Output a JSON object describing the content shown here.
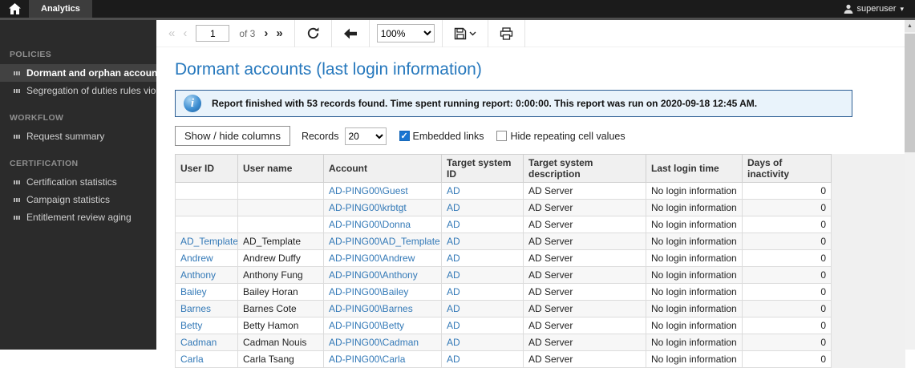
{
  "topbar": {
    "tab_label": "Analytics",
    "user_label": "superuser",
    "user_caret": "▾"
  },
  "sidebar": {
    "sections": [
      {
        "title": "POLICIES",
        "items": [
          {
            "label": "Dormant and orphan accounts",
            "active": true
          },
          {
            "label": "Segregation of duties rules viola...",
            "active": false
          }
        ]
      },
      {
        "title": "WORKFLOW",
        "items": [
          {
            "label": "Request summary",
            "active": false
          }
        ]
      },
      {
        "title": "CERTIFICATION",
        "items": [
          {
            "label": "Certification statistics",
            "active": false
          },
          {
            "label": "Campaign statistics",
            "active": false
          },
          {
            "label": "Entitlement review aging",
            "active": false
          }
        ]
      }
    ]
  },
  "toolbar": {
    "first_page_label": "«",
    "prev_page_label": "‹",
    "page_value": "1",
    "page_total_label": "of 3",
    "next_page_label": "›",
    "last_page_label": "»",
    "zoom_value": "100%"
  },
  "report": {
    "title": "Dormant accounts (last login information)",
    "info_message": "Report finished with 53 records found. Time spent running report: 0:00:00. This report was run on 2020-09-18 12:45 AM.",
    "controls": {
      "show_hide_button": "Show / hide columns",
      "records_label": "Records",
      "records_value": "20",
      "embedded_links_label": "Embedded links",
      "embedded_links_checked": true,
      "hide_repeating_label": "Hide repeating cell values",
      "hide_repeating_checked": false
    }
  },
  "table": {
    "columns": [
      "User ID",
      "User name",
      "Account",
      "Target system ID",
      "Target system description",
      "Last login time",
      "Days of inactivity"
    ],
    "rows": [
      {
        "user_id": "",
        "user_name": "",
        "account": "AD-PING00\\Guest",
        "target_system_id": "AD",
        "target_system_description": "AD Server",
        "last_login_time": "No login information",
        "days_of_inactivity": "0"
      },
      {
        "user_id": "",
        "user_name": "",
        "account": "AD-PING00\\krbtgt",
        "target_system_id": "AD",
        "target_system_description": "AD Server",
        "last_login_time": "No login information",
        "days_of_inactivity": "0"
      },
      {
        "user_id": "",
        "user_name": "",
        "account": "AD-PING00\\Donna",
        "target_system_id": "AD",
        "target_system_description": "AD Server",
        "last_login_time": "No login information",
        "days_of_inactivity": "0"
      },
      {
        "user_id": "AD_Template",
        "user_name": "AD_Template",
        "account": "AD-PING00\\AD_Template",
        "target_system_id": "AD",
        "target_system_description": "AD Server",
        "last_login_time": "No login information",
        "days_of_inactivity": "0"
      },
      {
        "user_id": "Andrew",
        "user_name": "Andrew Duffy",
        "account": "AD-PING00\\Andrew",
        "target_system_id": "AD",
        "target_system_description": "AD Server",
        "last_login_time": "No login information",
        "days_of_inactivity": "0"
      },
      {
        "user_id": "Anthony",
        "user_name": "Anthony Fung",
        "account": "AD-PING00\\Anthony",
        "target_system_id": "AD",
        "target_system_description": "AD Server",
        "last_login_time": "No login information",
        "days_of_inactivity": "0"
      },
      {
        "user_id": "Bailey",
        "user_name": "Bailey Horan",
        "account": "AD-PING00\\Bailey",
        "target_system_id": "AD",
        "target_system_description": "AD Server",
        "last_login_time": "No login information",
        "days_of_inactivity": "0"
      },
      {
        "user_id": "Barnes",
        "user_name": "Barnes Cote",
        "account": "AD-PING00\\Barnes",
        "target_system_id": "AD",
        "target_system_description": "AD Server",
        "last_login_time": "No login information",
        "days_of_inactivity": "0"
      },
      {
        "user_id": "Betty",
        "user_name": "Betty Hamon",
        "account": "AD-PING00\\Betty",
        "target_system_id": "AD",
        "target_system_description": "AD Server",
        "last_login_time": "No login information",
        "days_of_inactivity": "0"
      },
      {
        "user_id": "Cadman",
        "user_name": "Cadman Nouis",
        "account": "AD-PING00\\Cadman",
        "target_system_id": "AD",
        "target_system_description": "AD Server",
        "last_login_time": "No login information",
        "days_of_inactivity": "0"
      },
      {
        "user_id": "Carla",
        "user_name": "Carla Tsang",
        "account": "AD-PING00\\Carla",
        "target_system_id": "AD",
        "target_system_description": "AD Server",
        "last_login_time": "No login information",
        "days_of_inactivity": "0"
      }
    ]
  },
  "colors": {
    "topbar_bg": "#1b1b1b",
    "sidebar_bg": "#2b2b2b",
    "sidebar_active_bg": "#424242",
    "title_blue": "#2678bd",
    "link_blue": "#3379b7",
    "info_bg": "#e9f3fb",
    "info_border": "#2d5e94",
    "checkbox_blue": "#1975d1",
    "table_header_bg": "#f0f0f0"
  }
}
